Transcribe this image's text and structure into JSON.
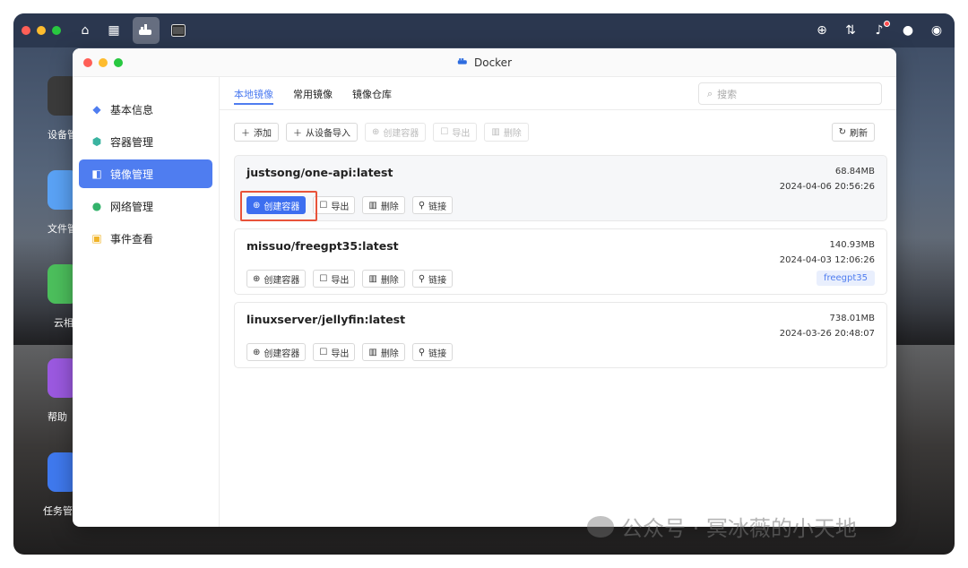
{
  "window": {
    "title": "Docker"
  },
  "desktop": {
    "labels": [
      "设备管",
      "文件管",
      "云相",
      "帮助",
      "任务管"
    ]
  },
  "sidebar": {
    "items": [
      {
        "label": "基本信息",
        "icon": "docker-icon"
      },
      {
        "label": "容器管理",
        "icon": "cube-icon"
      },
      {
        "label": "镜像管理",
        "icon": "image-icon"
      },
      {
        "label": "网络管理",
        "icon": "globe-icon"
      },
      {
        "label": "事件查看",
        "icon": "event-icon"
      }
    ],
    "active_index": 2
  },
  "tabs": [
    {
      "label": "本地镜像"
    },
    {
      "label": "常用镜像"
    },
    {
      "label": "镜像仓库"
    }
  ],
  "search": {
    "placeholder": "搜索"
  },
  "toolbar": {
    "add": "添加",
    "import": "从设备导入",
    "create": "创建容器",
    "export": "导出",
    "delete": "删除",
    "refresh": "刷新"
  },
  "actions": {
    "create": "创建容器",
    "export": "导出",
    "delete": "删除",
    "link": "链接"
  },
  "images": [
    {
      "name": "justsong/one-api:latest",
      "size": "68.84MB",
      "date": "2024-04-06 20:56:26",
      "tag": ""
    },
    {
      "name": "missuo/freegpt35:latest",
      "size": "140.93MB",
      "date": "2024-04-03 12:06:26",
      "tag": "freegpt35"
    },
    {
      "name": "linuxserver/jellyfin:latest",
      "size": "738.01MB",
      "date": "2024-03-26 20:48:07",
      "tag": ""
    }
  ],
  "watermark": "公众号 · 冥冰薇的小天地",
  "colors": {
    "accent": "#4f7df0",
    "highlight": "#e8533a"
  }
}
